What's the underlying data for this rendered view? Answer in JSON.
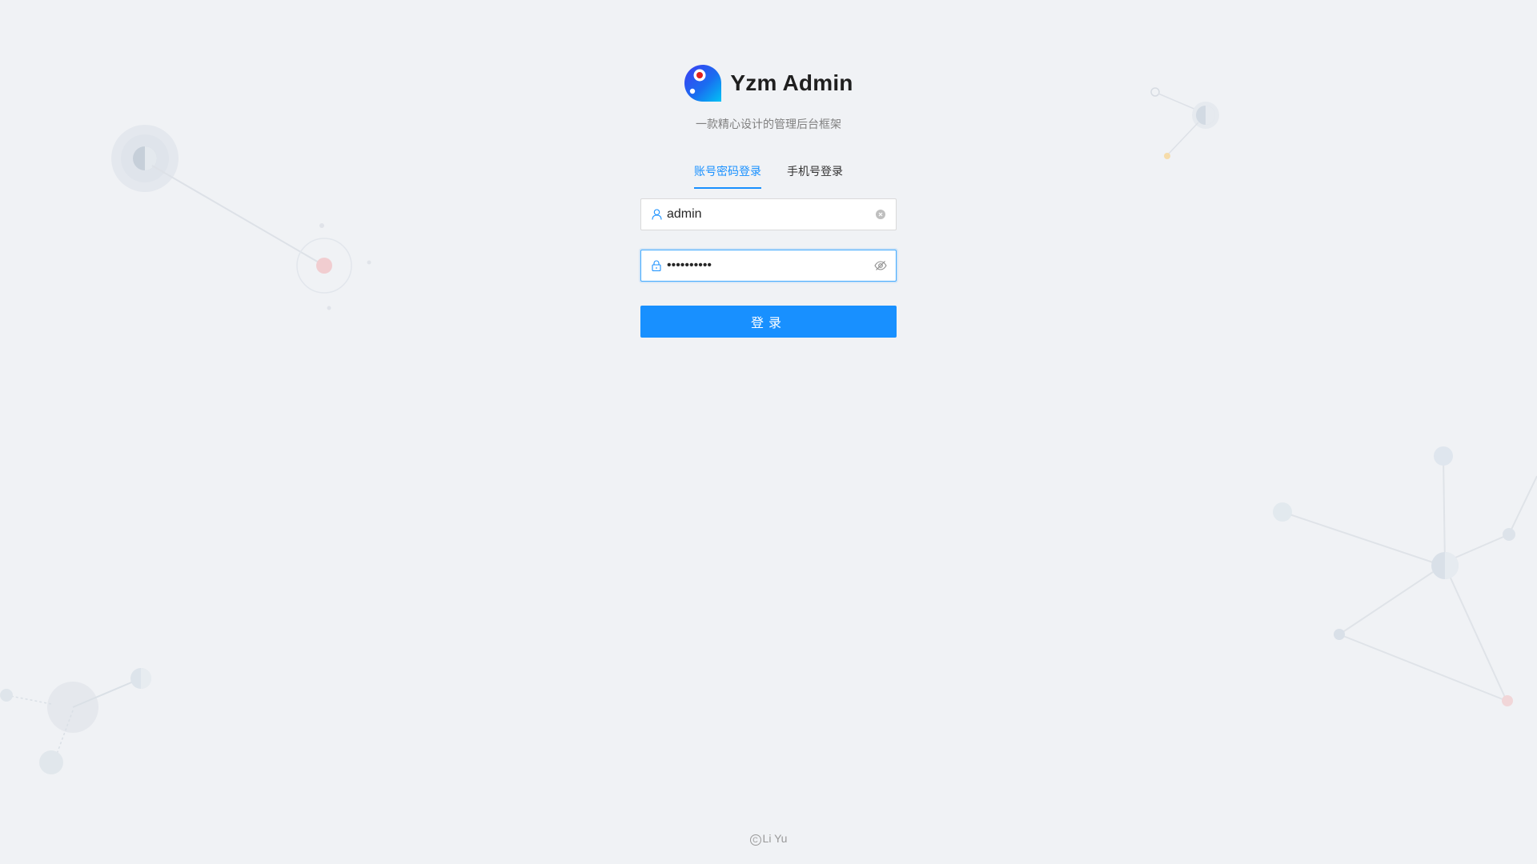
{
  "brand": {
    "title": "Yzm Admin",
    "subtitle": "一款精心设计的管理后台框架"
  },
  "tabs": [
    {
      "label": "账号密码登录",
      "active": true
    },
    {
      "label": "手机号登录",
      "active": false
    }
  ],
  "username": {
    "value": "admin",
    "icon": "user-icon",
    "clear_icon": "clear-icon"
  },
  "password": {
    "value": "••••••••••",
    "icon": "lock-icon",
    "toggle_icon": "eye-invisible-icon"
  },
  "login_button": {
    "label": "登录"
  },
  "footer": {
    "copyright_symbol": "C",
    "text": "Li Yu"
  },
  "colors": {
    "primary": "#1890ff",
    "background": "#f0f2f5",
    "text_secondary": "#808080"
  }
}
